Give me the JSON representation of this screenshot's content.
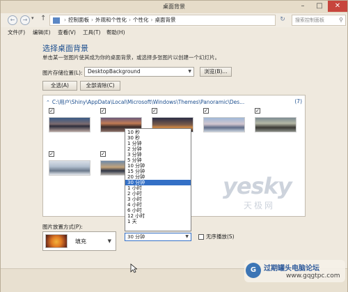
{
  "window": {
    "title": "桌面背景"
  },
  "address": {
    "breadcrumbs": [
      "控制面板",
      "外观和个性化",
      "个性化",
      "桌面背景"
    ],
    "search_placeholder": "搜索控制面板"
  },
  "menu": [
    "文件(F)",
    "编辑(E)",
    "查看(V)",
    "工具(T)",
    "帮助(H)"
  ],
  "content": {
    "heading": "选择桌面背景",
    "description": "单击某一张图片使其成为你的桌面背景，或选择多张图片以创建一个幻灯片。",
    "location_label": "图片存储位置(L):",
    "location_value": "DesktopBackground",
    "browse_label": "浏览(B)...",
    "select_all_label": "全选(A)",
    "clear_all_label": "全部清除(C)",
    "group_path": "C:\\用户\\Shiny\\AppData\\Local\\Microsoft\\Windows\\Themes\\Panoramic\\Des...",
    "group_count": "(7)"
  },
  "thumbnails": [
    {
      "checked": true,
      "check_mark": "✓"
    },
    {
      "checked": true,
      "check_mark": "✓"
    },
    {
      "checked": true,
      "check_mark": "✓"
    },
    {
      "checked": true,
      "check_mark": "✓"
    },
    {
      "checked": true,
      "check_mark": "✓"
    },
    {
      "checked": true,
      "check_mark": "✓"
    },
    {
      "checked": true,
      "check_mark": "✓"
    }
  ],
  "interval_dropdown": {
    "options": [
      "10 秒",
      "30 秒",
      "1 分钟",
      "2 分钟",
      "3 分钟",
      "5 分钟",
      "10 分钟",
      "15 分钟",
      "20 分钟",
      "30 分钟",
      "1 小时",
      "2 小时",
      "3 小时",
      "4 小时",
      "6 小时",
      "12 小时",
      "1 天"
    ],
    "highlighted": "30 分钟",
    "selected_value": "30 分钟"
  },
  "position": {
    "label": "图片放置方式(P):",
    "value": "填充"
  },
  "shuffle_label": "无序播放(S)",
  "watermark": {
    "logo": "yesky",
    "subtitle": "天极网"
  },
  "stamp": {
    "text": "过期罐头电脑论坛",
    "url": "www.gqgtpc.com",
    "badge": "G"
  },
  "colors": {
    "accent": "#3470c6",
    "heading": "#1d4f8f",
    "close": "#c7453c"
  }
}
